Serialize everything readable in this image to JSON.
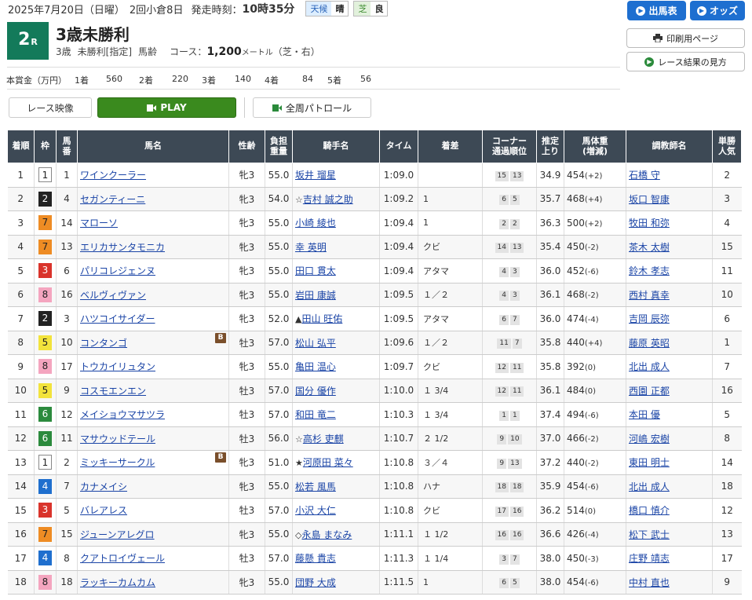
{
  "header": {
    "date_text": "2025年7月20日（日曜）",
    "meeting": "2回小倉8日",
    "start_label": "発走時刻：",
    "start_time": "10時35分",
    "weather_label": "天候",
    "weather": "晴",
    "track_label": "芝",
    "track_cond": "良"
  },
  "race": {
    "number": "2",
    "number_suffix": "R",
    "title": "3歳未勝利",
    "age": "3歳",
    "class": "未勝利[指定]",
    "weight_rule": "馬齢",
    "course_label": "コース：",
    "distance": "1,200",
    "distance_unit": "メートル",
    "surface": "（芝・右）"
  },
  "prize": {
    "label": "本賞金（万円）",
    "items": [
      {
        "place": "1着",
        "amount": "560"
      },
      {
        "place": "2着",
        "amount": "220"
      },
      {
        "place": "3着",
        "amount": "140"
      },
      {
        "place": "4着",
        "amount": "84"
      },
      {
        "place": "5着",
        "amount": "56"
      }
    ]
  },
  "buttons": {
    "entries": "出馬表",
    "odds": "オッズ",
    "print": "印刷用ページ",
    "howto": "レース結果の見方",
    "video_label": "レース映像",
    "play": "PLAY",
    "patrol": "全周パトロール"
  },
  "columns": {
    "rank": "着順",
    "waku": "枠",
    "num": "馬番",
    "horse": "馬名",
    "sexage": "性齢",
    "weight": "負担重量",
    "jockey": "騎手名",
    "time": "タイム",
    "margin": "着差",
    "corner": "コーナー通過順位",
    "last3f": "推定上り",
    "bodyweight": "馬体重(増減)",
    "trainer": "調教師名",
    "pop": "単勝人気"
  },
  "results": [
    {
      "rank": "1",
      "waku": "1",
      "num": "1",
      "horse": "ワインクーラー",
      "blinker": "",
      "sexage": "牝3",
      "weight": "55.0",
      "mark": "",
      "jockey": "坂井 瑠星",
      "time": "1:09.0",
      "margin": "",
      "c1": "15",
      "c2": "13",
      "last3f": "34.9",
      "bw": "454",
      "bwd": "(+2)",
      "trainer": "石橋 守",
      "pop": "2"
    },
    {
      "rank": "2",
      "waku": "2",
      "num": "4",
      "horse": "セガンティーニ",
      "blinker": "",
      "sexage": "牝3",
      "weight": "54.0",
      "mark": "☆",
      "jockey": "吉村 誠之助",
      "time": "1:09.2",
      "margin": "1",
      "c1": "6",
      "c2": "5",
      "last3f": "35.7",
      "bw": "468",
      "bwd": "(+4)",
      "trainer": "坂口 智康",
      "pop": "3"
    },
    {
      "rank": "3",
      "waku": "7",
      "num": "14",
      "horse": "マローソ",
      "blinker": "",
      "sexage": "牝3",
      "weight": "55.0",
      "mark": "",
      "jockey": "小崎 綾也",
      "time": "1:09.4",
      "margin": "1",
      "c1": "2",
      "c2": "2",
      "last3f": "36.3",
      "bw": "500",
      "bwd": "(+2)",
      "trainer": "牧田 和弥",
      "pop": "4"
    },
    {
      "rank": "4",
      "waku": "7",
      "num": "13",
      "horse": "エリカサンタモニカ",
      "blinker": "",
      "sexage": "牝3",
      "weight": "55.0",
      "mark": "",
      "jockey": "幸 英明",
      "time": "1:09.4",
      "margin": "クビ",
      "c1": "14",
      "c2": "13",
      "last3f": "35.4",
      "bw": "450",
      "bwd": "(-2)",
      "trainer": "茶木 太樹",
      "pop": "15"
    },
    {
      "rank": "5",
      "waku": "3",
      "num": "6",
      "horse": "パリコレジェンヌ",
      "blinker": "",
      "sexage": "牝3",
      "weight": "55.0",
      "mark": "",
      "jockey": "田口 貫太",
      "time": "1:09.4",
      "margin": "アタマ",
      "c1": "4",
      "c2": "3",
      "last3f": "36.0",
      "bw": "452",
      "bwd": "(-6)",
      "trainer": "鈴木 孝志",
      "pop": "11"
    },
    {
      "rank": "6",
      "waku": "8",
      "num": "16",
      "horse": "ベルヴィヴァン",
      "blinker": "",
      "sexage": "牝3",
      "weight": "55.0",
      "mark": "",
      "jockey": "岩田 康誠",
      "time": "1:09.5",
      "margin": "１／２",
      "c1": "4",
      "c2": "3",
      "last3f": "36.1",
      "bw": "468",
      "bwd": "(-2)",
      "trainer": "西村 真幸",
      "pop": "10"
    },
    {
      "rank": "7",
      "waku": "2",
      "num": "3",
      "horse": "ハツコイサイダー",
      "blinker": "",
      "sexage": "牝3",
      "weight": "52.0",
      "mark": "▲",
      "jockey": "田山 旺佑",
      "time": "1:09.5",
      "margin": "アタマ",
      "c1": "6",
      "c2": "7",
      "last3f": "36.0",
      "bw": "474",
      "bwd": "(-4)",
      "trainer": "吉岡 辰弥",
      "pop": "6"
    },
    {
      "rank": "8",
      "waku": "5",
      "num": "10",
      "horse": "コンタンゴ",
      "blinker": "B",
      "sexage": "牡3",
      "weight": "57.0",
      "mark": "",
      "jockey": "松山 弘平",
      "time": "1:09.6",
      "margin": "１／２",
      "c1": "11",
      "c2": "7",
      "last3f": "35.8",
      "bw": "440",
      "bwd": "(+4)",
      "trainer": "藤原 英昭",
      "pop": "1"
    },
    {
      "rank": "9",
      "waku": "8",
      "num": "17",
      "horse": "トウカイリュタン",
      "blinker": "",
      "sexage": "牝3",
      "weight": "55.0",
      "mark": "",
      "jockey": "亀田 温心",
      "time": "1:09.7",
      "margin": "クビ",
      "c1": "12",
      "c2": "11",
      "last3f": "35.8",
      "bw": "392",
      "bwd": "(0)",
      "trainer": "北出 成人",
      "pop": "7"
    },
    {
      "rank": "10",
      "waku": "5",
      "num": "9",
      "horse": "コスモエンエン",
      "blinker": "",
      "sexage": "牡3",
      "weight": "57.0",
      "mark": "",
      "jockey": "国分 優作",
      "time": "1:10.0",
      "margin": "１ 3/4",
      "c1": "12",
      "c2": "11",
      "last3f": "36.1",
      "bw": "484",
      "bwd": "(0)",
      "trainer": "西園 正都",
      "pop": "16"
    },
    {
      "rank": "11",
      "waku": "6",
      "num": "12",
      "horse": "メイショウマサツラ",
      "blinker": "",
      "sexage": "牡3",
      "weight": "57.0",
      "mark": "",
      "jockey": "和田 竜二",
      "time": "1:10.3",
      "margin": "１ 3/4",
      "c1": "1",
      "c2": "1",
      "last3f": "37.4",
      "bw": "494",
      "bwd": "(-6)",
      "trainer": "本田 優",
      "pop": "5"
    },
    {
      "rank": "12",
      "waku": "6",
      "num": "11",
      "horse": "マサウッドテール",
      "blinker": "",
      "sexage": "牡3",
      "weight": "56.0",
      "mark": "☆",
      "jockey": "高杉 吏麒",
      "time": "1:10.7",
      "margin": "２ 1/2",
      "c1": "9",
      "c2": "10",
      "last3f": "37.0",
      "bw": "466",
      "bwd": "(-2)",
      "trainer": "河嶋 宏樹",
      "pop": "8"
    },
    {
      "rank": "13",
      "waku": "1",
      "num": "2",
      "horse": "ミッキーサークル",
      "blinker": "B",
      "sexage": "牝3",
      "weight": "51.0",
      "mark": "★",
      "jockey": "河原田 菜々",
      "time": "1:10.8",
      "margin": "３／４",
      "c1": "9",
      "c2": "13",
      "last3f": "37.2",
      "bw": "440",
      "bwd": "(-2)",
      "trainer": "東田 明士",
      "pop": "14"
    },
    {
      "rank": "14",
      "waku": "4",
      "num": "7",
      "horse": "カナメイシ",
      "blinker": "",
      "sexage": "牝3",
      "weight": "55.0",
      "mark": "",
      "jockey": "松若 風馬",
      "time": "1:10.8",
      "margin": "ハナ",
      "c1": "18",
      "c2": "18",
      "last3f": "35.9",
      "bw": "454",
      "bwd": "(-6)",
      "trainer": "北出 成人",
      "pop": "18"
    },
    {
      "rank": "15",
      "waku": "3",
      "num": "5",
      "horse": "バレアレス",
      "blinker": "",
      "sexage": "牡3",
      "weight": "57.0",
      "mark": "",
      "jockey": "小沢 大仁",
      "time": "1:10.8",
      "margin": "クビ",
      "c1": "17",
      "c2": "16",
      "last3f": "36.2",
      "bw": "514",
      "bwd": "(0)",
      "trainer": "橋口 慎介",
      "pop": "12"
    },
    {
      "rank": "16",
      "waku": "7",
      "num": "15",
      "horse": "ジューンアレグロ",
      "blinker": "",
      "sexage": "牝3",
      "weight": "55.0",
      "mark": "◇",
      "jockey": "永島 まなみ",
      "time": "1:11.1",
      "margin": "１ 1/2",
      "c1": "16",
      "c2": "16",
      "last3f": "36.6",
      "bw": "426",
      "bwd": "(-4)",
      "trainer": "松下 武士",
      "pop": "13"
    },
    {
      "rank": "17",
      "waku": "4",
      "num": "8",
      "horse": "クアトロイヴェール",
      "blinker": "",
      "sexage": "牡3",
      "weight": "57.0",
      "mark": "",
      "jockey": "藤懸 貴志",
      "time": "1:11.3",
      "margin": "１ 1/4",
      "c1": "3",
      "c2": "7",
      "last3f": "38.0",
      "bw": "450",
      "bwd": "(-3)",
      "trainer": "庄野 靖志",
      "pop": "17"
    },
    {
      "rank": "18",
      "waku": "8",
      "num": "18",
      "horse": "ラッキーカムカム",
      "blinker": "",
      "sexage": "牝3",
      "weight": "55.0",
      "mark": "",
      "jockey": "団野 大成",
      "time": "1:11.5",
      "margin": "1",
      "c1": "6",
      "c2": "5",
      "last3f": "38.0",
      "bw": "454",
      "bwd": "(-6)",
      "trainer": "中村 直也",
      "pop": "9"
    }
  ]
}
